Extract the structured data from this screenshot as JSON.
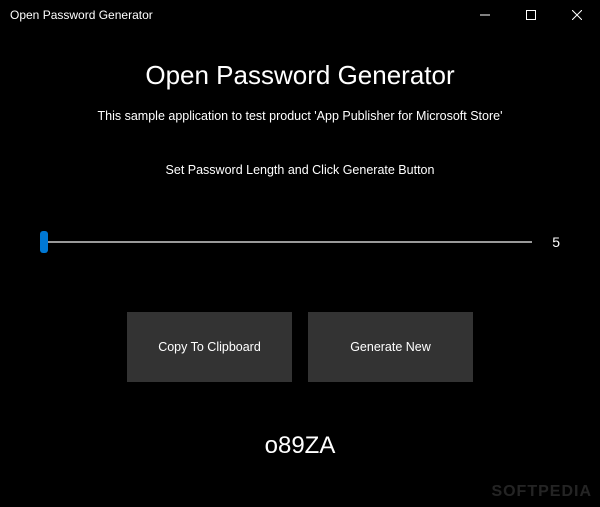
{
  "titlebar": {
    "title": "Open Password Generator"
  },
  "main": {
    "heading": "Open Password Generator",
    "subtitle": "This sample application to test product 'App Publisher for Microsoft Store'",
    "instruction": "Set Password Length and Click Generate Button",
    "slider_value": "5",
    "buttons": {
      "copy": "Copy To Clipboard",
      "generate": "Generate New"
    },
    "result": "o89ZA"
  },
  "watermark": "SOFTPEDIA"
}
